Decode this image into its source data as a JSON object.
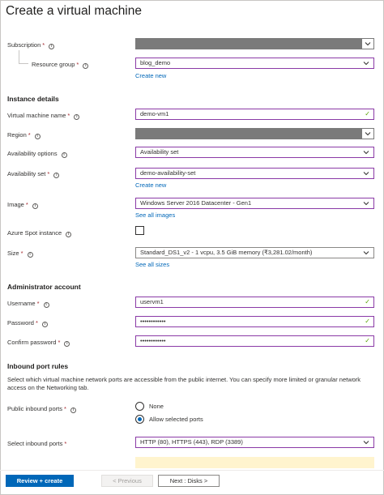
{
  "page": {
    "title": "Create a virtual machine"
  },
  "project": {
    "subscription_label": "Subscription",
    "resource_group_label": "Resource group",
    "resource_group_value": "blog_demo",
    "create_new": "Create new"
  },
  "instance": {
    "heading": "Instance details",
    "vm_name_label": "Virtual machine name",
    "vm_name_value": "demo-vm1",
    "region_label": "Region",
    "availability_options_label": "Availability options",
    "availability_options_value": "Availability set",
    "availability_set_label": "Availability set",
    "availability_set_value": "demo-availability-set",
    "create_new": "Create new",
    "image_label": "Image",
    "image_value": "Windows Server 2016 Datacenter - Gen1",
    "see_all_images": "See all images",
    "spot_label": "Azure Spot instance",
    "size_label": "Size",
    "size_value": "Standard_DS1_v2 - 1 vcpu, 3.5 GiB memory (₹3,281.02/month)",
    "see_all_sizes": "See all sizes"
  },
  "admin": {
    "heading": "Administrator account",
    "username_label": "Username",
    "username_value": "uservm1",
    "password_label": "Password",
    "password_value": "••••••••••••",
    "confirm_label": "Confirm password",
    "confirm_value": "••••••••••••"
  },
  "inbound": {
    "heading": "Inbound port rules",
    "description": "Select which virtual machine network ports are accessible from the public internet. You can specify more limited or granular network access on the Networking tab.",
    "public_ports_label": "Public inbound ports",
    "option_none": "None",
    "option_allow": "Allow selected ports",
    "selected_option": "Allow selected ports",
    "select_ports_label": "Select inbound ports",
    "select_ports_value": "HTTP (80), HTTPS (443), RDP (3389)"
  },
  "footer": {
    "review_create": "Review + create",
    "previous": "< Previous",
    "next": "Next : Disks >"
  },
  "colors": {
    "accent": "#0067b8",
    "focus_border": "#8a3aa6",
    "valid_check": "#57a300",
    "required": "#a4262c",
    "warning_bg": "#fff4ce"
  },
  "icons": [
    "info-icon",
    "chevron-down-icon",
    "checkmark-icon"
  ]
}
